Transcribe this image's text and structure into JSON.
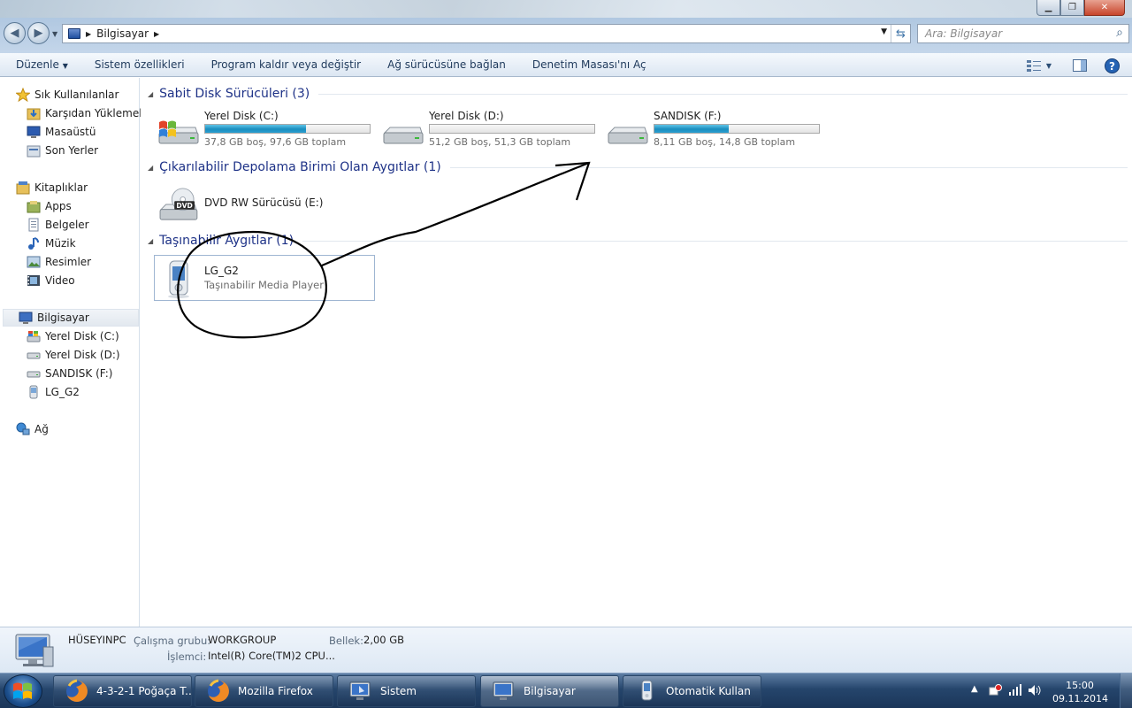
{
  "window": {
    "address_segment": "Bilgisayar",
    "search_placeholder": "Ara: Bilgisayar"
  },
  "toolbar": {
    "items": [
      "Düzenle",
      "Sistem özellikleri",
      "Program kaldır veya değiştir",
      "Ağ sürücüsüne bağlan",
      "Denetim Masası'nı Aç"
    ]
  },
  "sidebar": {
    "favorites": {
      "label": "Sık Kullanılanlar",
      "items": [
        "Karşıdan Yüklemeler",
        "Masaüstü",
        "Son Yerler"
      ]
    },
    "libraries": {
      "label": "Kitaplıklar",
      "items": [
        "Apps",
        "Belgeler",
        "Müzik",
        "Resimler",
        "Video"
      ]
    },
    "computer": {
      "label": "Bilgisayar",
      "items": [
        "Yerel Disk (C:)",
        "Yerel Disk (D:)",
        "SANDISK (F:)",
        "LG_G2"
      ]
    },
    "network": {
      "label": "Ağ"
    }
  },
  "groups": {
    "hard_disks": {
      "title": "Sabit Disk Sürücüleri (3)",
      "drives": [
        {
          "name": "Yerel Disk (C:)",
          "free_text": "37,8 GB boş, 97,6 GB toplam",
          "used_fraction": 0.613
        },
        {
          "name": "Yerel Disk (D:)",
          "free_text": "51,2 GB boş, 51,3 GB toplam",
          "used_fraction": 0.002
        },
        {
          "name": "SANDISK (F:)",
          "free_text": "8,11 GB boş, 14,8 GB toplam",
          "used_fraction": 0.452
        }
      ]
    },
    "removable": {
      "title": "Çıkarılabilir Depolama Birimi Olan Aygıtlar (1)",
      "drive": {
        "name": "DVD RW Sürücüsü (E:)"
      }
    },
    "portable": {
      "title": "Taşınabilir Aygıtlar (1)",
      "device": {
        "name": "LG_G2",
        "type": "Taşınabilir Media Player"
      }
    }
  },
  "details": {
    "computer_name": "HÜSEYINPC",
    "workgroup_label": "Çalışma grubu:",
    "workgroup": "WORKGROUP",
    "memory_label": "Bellek:",
    "memory": "2,00 GB",
    "processor_label": "İşlemci:",
    "processor": "Intel(R) Core(TM)2 CPU..."
  },
  "taskbar": {
    "tasks": [
      {
        "label": "4-3-2-1 Poğaça T...",
        "icon": "firefox-icon",
        "active": false
      },
      {
        "label": "Mozilla Firefox",
        "icon": "firefox-icon",
        "active": false
      },
      {
        "label": "Sistem",
        "icon": "computer-icon",
        "active": false
      },
      {
        "label": "Bilgisayar",
        "icon": "computer-icon",
        "active": true
      },
      {
        "label": "Otomatik Kullan",
        "icon": "phone-icon",
        "active": false
      }
    ],
    "time": "15:00",
    "date": "09.11.2014"
  }
}
